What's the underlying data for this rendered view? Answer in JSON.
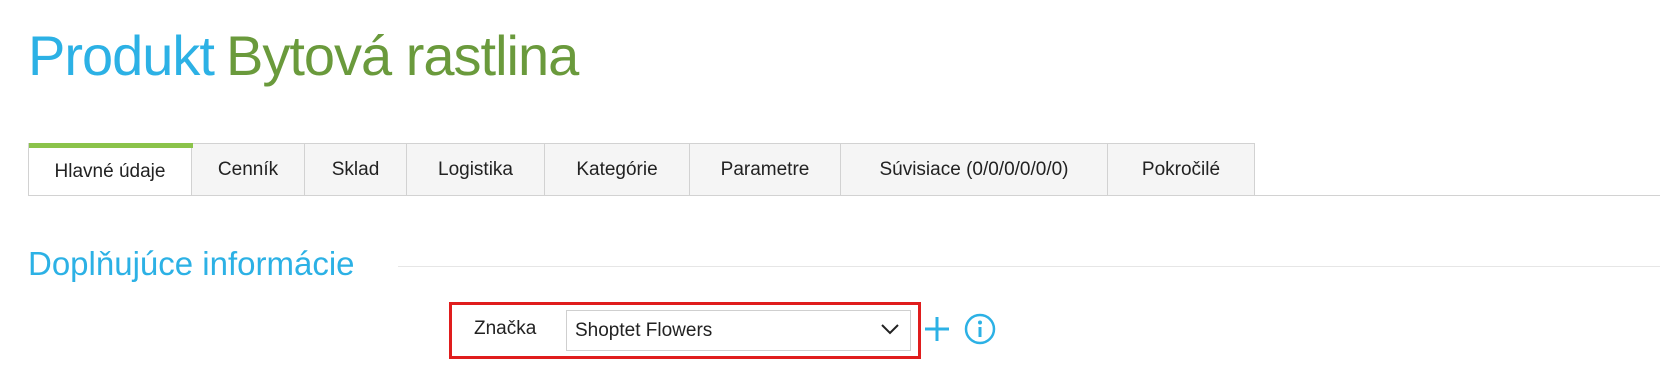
{
  "header": {
    "title_prefix": "Produkt",
    "title_name": "Bytová rastlina"
  },
  "tabs": [
    {
      "label": "Hlavné údaje",
      "active": true
    },
    {
      "label": "Cenník",
      "active": false
    },
    {
      "label": "Sklad",
      "active": false
    },
    {
      "label": "Logistika",
      "active": false
    },
    {
      "label": "Kategórie",
      "active": false
    },
    {
      "label": "Parametre",
      "active": false
    },
    {
      "label": "Súvisiace (0/0/0/0/0/0)",
      "active": false
    },
    {
      "label": "Pokročilé",
      "active": false
    }
  ],
  "section": {
    "heading": "Doplňujúce informácie"
  },
  "brand_field": {
    "label": "Značka",
    "selected_value": "Shoptet Flowers",
    "dropdown_icon": "chevron-down-icon",
    "add_icon": "plus-icon",
    "info_icon": "info-icon"
  },
  "colors": {
    "title_prefix": "#2cb1e5",
    "title_name": "#6a9a3c",
    "active_tab_indicator": "#8bc34a",
    "section_heading": "#2cb1e5",
    "highlight_border": "#e01d1d",
    "icon_accent": "#2cb1e5"
  }
}
